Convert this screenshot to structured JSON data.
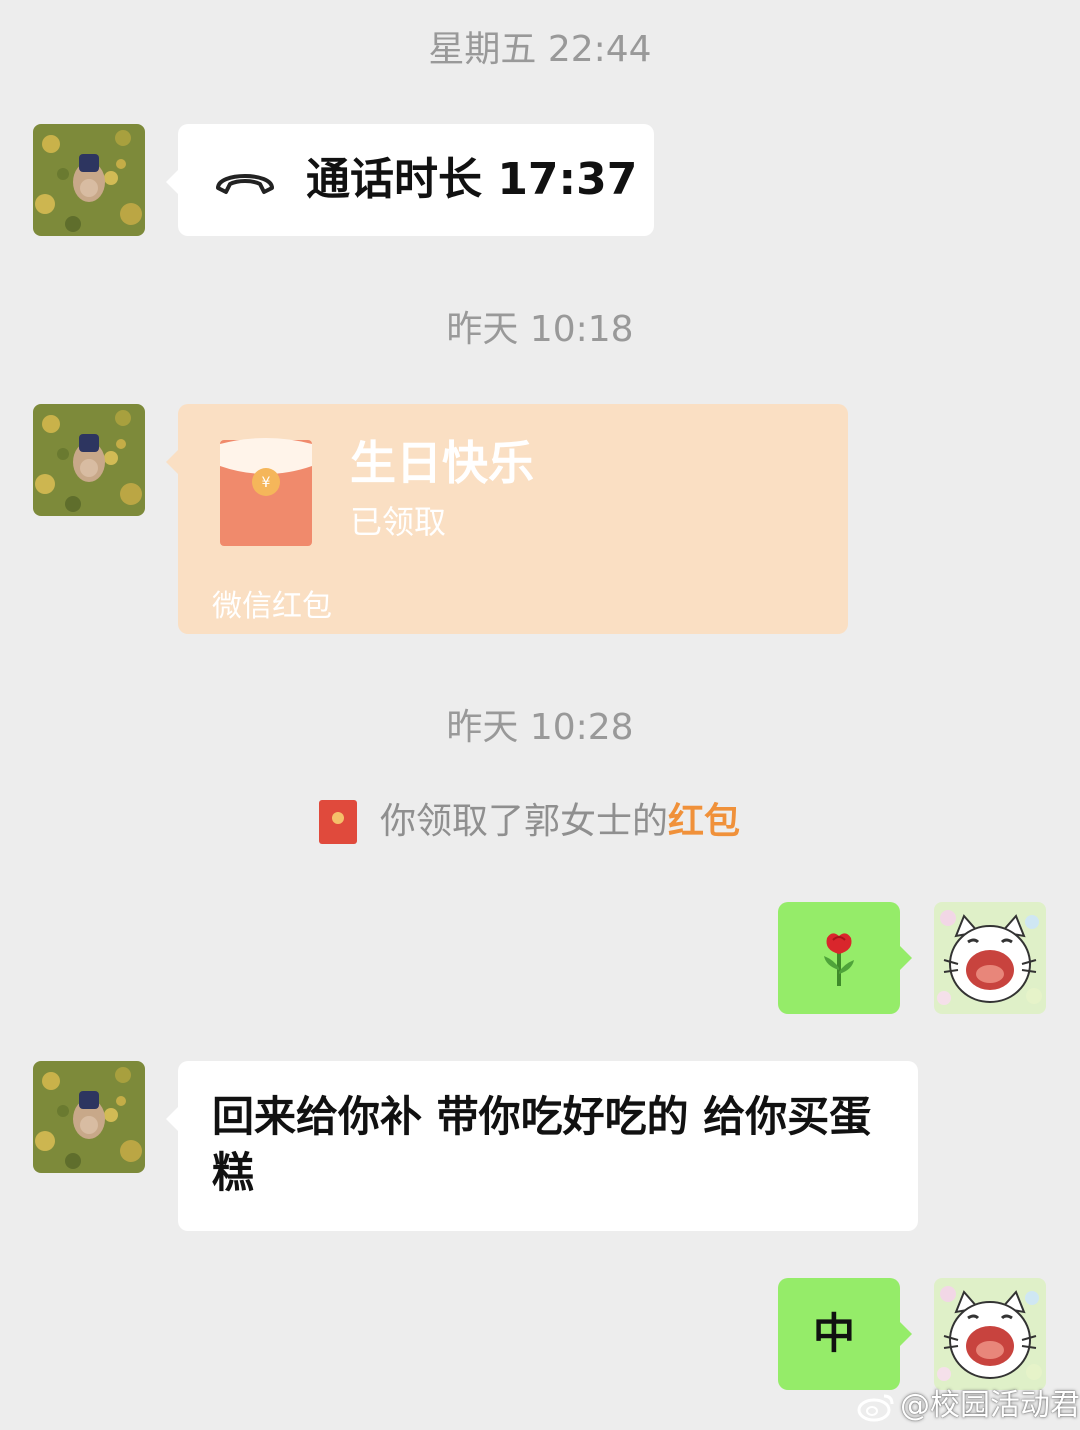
{
  "chat": {
    "timestamps": [
      "星期五 22:44",
      "昨天 10:18",
      "昨天 10:28"
    ],
    "call_message": {
      "icon": "phone-hangup-icon",
      "text": "通话时长 17:37"
    },
    "red_packet": {
      "icon": "red-envelope-icon",
      "title": "生日快乐",
      "status": "已领取",
      "footer": "微信红包",
      "coin_symbol": "¥"
    },
    "system_notice": {
      "icon": "red-envelope-small-icon",
      "text_prefix": "你领取了郭女士的",
      "text_link": "红包"
    },
    "sent_emoji": {
      "icon": "rose-icon"
    },
    "received_text": "回来给你补 带你吃好吃的 给你买蛋糕",
    "sent_text": "中"
  },
  "watermark": {
    "icon": "weibo-icon",
    "text": "@校园活动君"
  },
  "colors": {
    "background": "#ededed",
    "sent_bubble": "#95ec69",
    "received_bubble": "#ffffff",
    "red_packet_card": "#fadfc3",
    "red_packet_accent": "#f0913a",
    "timestamp_text": "#999999"
  }
}
